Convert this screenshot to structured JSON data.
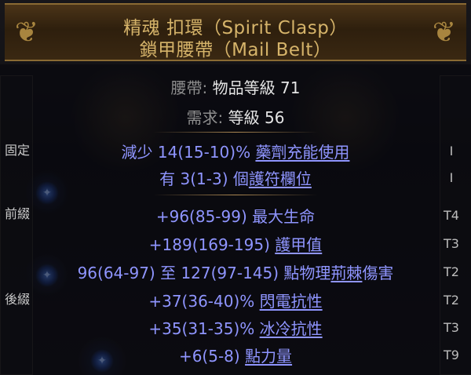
{
  "header": {
    "title_line1": "精魂 扣環（Spirit Clasp）",
    "title_line2": "鎖甲腰帶（Mail Belt）",
    "left_ornament_icon": "ornate-corner-icon",
    "right_ornament_icon": "ornate-corner-icon"
  },
  "properties": {
    "item_class_label": "腰帶:",
    "item_level_value": "物品等級 71",
    "requirement_label": "需求:",
    "requirement_value": "等級 56"
  },
  "sections": {
    "implicit_label": "固定",
    "prefix_label": "前綴",
    "suffix_label": "後綴"
  },
  "mods": [
    {
      "pre": "減少 14(15-10)% ",
      "kw": "藥劑充能使用",
      "tier": "I"
    },
    {
      "pre": "有 3(1-3) 個",
      "kw": "護符欄位",
      "tier": "I"
    },
    {
      "pre": "+96(85-99) 最大生命",
      "kw": "",
      "tier": "T4"
    },
    {
      "pre": "+189(169-195) ",
      "kw": "護甲值",
      "tier": "T3"
    },
    {
      "pre": "96(64-97) 至 127(97-145) 點物理",
      "kw": "荊棘",
      "post": "傷害",
      "tier": "T2"
    },
    {
      "pre": "+37(36-40)% ",
      "kw": "閃電抗性",
      "tier": "T2"
    },
    {
      "pre": "+35(31-35)% ",
      "kw": "冰冷抗性",
      "tier": "T3"
    },
    {
      "pre": "+6(5-8) ",
      "kw": "點力量",
      "tier": "T9"
    }
  ],
  "colors": {
    "title": "#d6b46a",
    "mod_text": "#8f95ff",
    "label": "#8e8e8e",
    "value": "#e4e4e4"
  }
}
